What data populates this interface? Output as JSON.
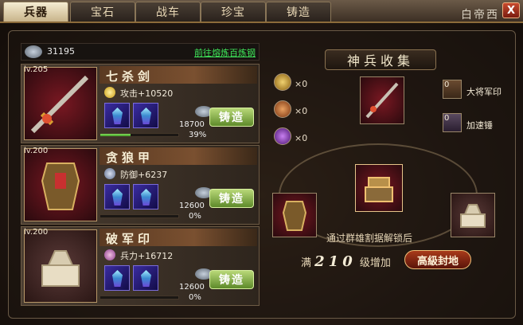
{
  "tabs": [
    {
      "label": "兵器",
      "active": true
    },
    {
      "label": "宝石",
      "active": false
    },
    {
      "label": "战车",
      "active": false
    },
    {
      "label": "珍宝",
      "active": false
    },
    {
      "label": "铸造",
      "active": false
    }
  ],
  "corner_text": "白帝西",
  "close_label": "X",
  "resource": {
    "value": "31195",
    "link": "前往熔炼百炼钢"
  },
  "weapons": [
    {
      "level": "lv.205",
      "name": "七杀剑",
      "stat": "攻击+10520",
      "cost": "18700",
      "forge": "铸造",
      "progress": 0.39,
      "progress_text": "39%"
    },
    {
      "level": "lv.200",
      "name": "贪狼甲",
      "stat": "防御+6237",
      "cost": "12600",
      "forge": "铸造",
      "progress": 0.0,
      "progress_text": "0%"
    },
    {
      "level": "lv.200",
      "name": "破军印",
      "stat": "兵力+16712",
      "cost": "12600",
      "forge": "铸造",
      "progress": 0.0,
      "progress_text": "0%"
    }
  ],
  "collection": {
    "title": "神兵收集",
    "hammers": [
      {
        "count": "×0",
        "color": "#c8a040"
      },
      {
        "count": "×0",
        "color": "#b86a30"
      },
      {
        "count": "×0",
        "color": "#8a3ac0"
      }
    ],
    "rewards": [
      {
        "count": "0",
        "label": "大将军印"
      },
      {
        "count": "0",
        "label": "加速锤"
      }
    ],
    "hint": "通过群雄割据解锁后",
    "unlock_prefix": "满",
    "unlock_level": "210",
    "unlock_suffix": "级增加",
    "badge": "高級封地"
  },
  "colors": {
    "accent_green": "#3fe85a",
    "forge_button": "#7aa83a"
  }
}
